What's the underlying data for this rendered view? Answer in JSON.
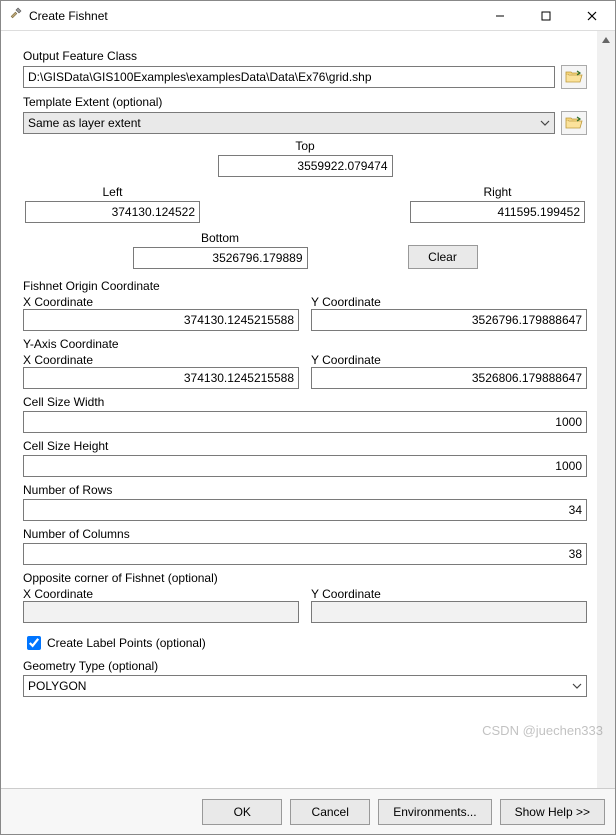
{
  "window": {
    "title": "Create Fishnet"
  },
  "outputFeatureClass": {
    "label": "Output Feature Class",
    "value": "D:\\GISData\\GIS100Examples\\examplesData\\Data\\Ex76\\grid.shp"
  },
  "templateExtent": {
    "label": "Template Extent (optional)",
    "selected": "Same as layer extent"
  },
  "extent": {
    "topLabel": "Top",
    "top": "3559922.079474",
    "leftLabel": "Left",
    "left": "374130.124522",
    "rightLabel": "Right",
    "right": "411595.199452",
    "bottomLabel": "Bottom",
    "bottom": "3526796.179889",
    "clear": "Clear"
  },
  "origin": {
    "heading": "Fishnet Origin Coordinate",
    "xLabel": "X Coordinate",
    "xValue": "374130.1245215588",
    "yLabel": "Y Coordinate",
    "yValue": "3526796.179888647"
  },
  "yaxis": {
    "heading": "Y-Axis Coordinate",
    "xLabel": "X Coordinate",
    "xValue": "374130.1245215588",
    "yLabel": "Y Coordinate",
    "yValue": "3526806.179888647"
  },
  "cellWidth": {
    "label": "Cell Size Width",
    "value": "1000"
  },
  "cellHeight": {
    "label": "Cell Size Height",
    "value": "1000"
  },
  "numRows": {
    "label": "Number of Rows",
    "value": "34"
  },
  "numCols": {
    "label": "Number of Columns",
    "value": "38"
  },
  "opposite": {
    "heading": "Opposite corner of Fishnet (optional)",
    "xLabel": "X Coordinate",
    "xValue": "",
    "yLabel": "Y Coordinate",
    "yValue": ""
  },
  "labelPoints": {
    "checked": true,
    "label": "Create Label Points (optional)"
  },
  "geometryType": {
    "label": "Geometry Type (optional)",
    "selected": "POLYGON"
  },
  "buttons": {
    "ok": "OK",
    "cancel": "Cancel",
    "environments": "Environments...",
    "showHelp": "Show Help >>"
  },
  "watermark": "CSDN @juechen333"
}
